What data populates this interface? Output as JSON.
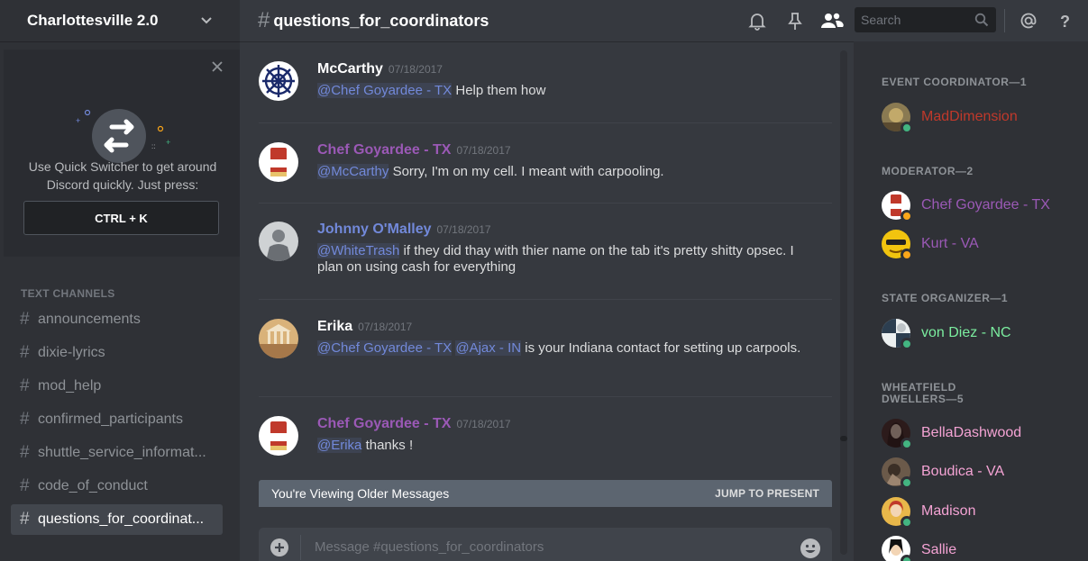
{
  "colors": {
    "online": "#43b581",
    "idle": "#faa61a",
    "mention": "#7289da",
    "event_coordinator": "#c0392b",
    "moderator": "#9b59b6",
    "state_organizer": "#7bed9f",
    "wheatfield": "#f4a3d4",
    "johnny": "#7289da"
  },
  "server": {
    "name": "Charlottesville 2.0",
    "chevron_icon": "chevron-down-icon"
  },
  "quick_switcher": {
    "text": "Use Quick Switcher to get around Discord quickly. Just press:",
    "shortcut": "CTRL + K"
  },
  "channels": {
    "heading": "TEXT CHANNELS",
    "items": [
      {
        "label": "announcements"
      },
      {
        "label": "dixie-lyrics"
      },
      {
        "label": "mod_help"
      },
      {
        "label": "confirmed_participants"
      },
      {
        "label": "shuttle_service_informat..."
      },
      {
        "label": "code_of_conduct"
      },
      {
        "label": "questions_for_coordinat..."
      }
    ],
    "active_index": 6
  },
  "header": {
    "hash": "#",
    "channel_title": "questions_for_coordinators",
    "search_placeholder": "Search",
    "icons": [
      "bell-icon",
      "pin-icon",
      "members-icon",
      "mention-icon",
      "help-icon"
    ]
  },
  "messages": [
    {
      "author": "McCarthy",
      "timestamp": "07/18/2017",
      "mentions": [
        "@Chef Goyardee - TX"
      ],
      "text": "Help them how"
    },
    {
      "author": "Chef Goyardee - TX",
      "timestamp": "07/18/2017",
      "mentions": [
        "@McCarthy"
      ],
      "text": "Sorry, I'm on my cell. I meant with carpooling."
    },
    {
      "author": "Johnny O'Malley",
      "timestamp": "07/18/2017",
      "mentions": [
        "@WhiteTrash"
      ],
      "text": "if they did thay with thier name on the tab it's pretty shitty opsec. I plan on using cash for everything"
    },
    {
      "author": "Erika",
      "timestamp": "07/18/2017",
      "mentions": [
        "@Chef Goyardee - TX",
        "@Ajax - IN"
      ],
      "text": "is your Indiana contact for setting up carpools."
    },
    {
      "author": "Chef Goyardee - TX",
      "timestamp": "07/18/2017",
      "mentions": [
        "@Erika"
      ],
      "text": "thanks !"
    }
  ],
  "older_bar": {
    "text": "You're Viewing Older Messages",
    "jump": "JUMP TO PRESENT"
  },
  "composer": {
    "placeholder": "Message #questions_for_coordinators"
  },
  "members": {
    "groups": [
      {
        "heading": "EVENT COORDINATOR—1",
        "members": [
          {
            "name": "MadDimension",
            "status": "online"
          }
        ]
      },
      {
        "heading": "MODERATOR—2",
        "members": [
          {
            "name": "Chef Goyardee - TX",
            "status": "idle"
          },
          {
            "name": "Kurt - VA",
            "status": "idle"
          }
        ]
      },
      {
        "heading": "STATE ORGANIZER—1",
        "members": [
          {
            "name": "von Diez - NC",
            "status": "online"
          }
        ]
      },
      {
        "heading": "WHEATFIELD DWELLERS—5",
        "members": [
          {
            "name": "BellaDashwood",
            "status": "online"
          },
          {
            "name": "Boudica - VA",
            "status": "online"
          },
          {
            "name": "Madison",
            "status": "online"
          },
          {
            "name": "Sallie",
            "status": "online"
          }
        ]
      }
    ]
  }
}
